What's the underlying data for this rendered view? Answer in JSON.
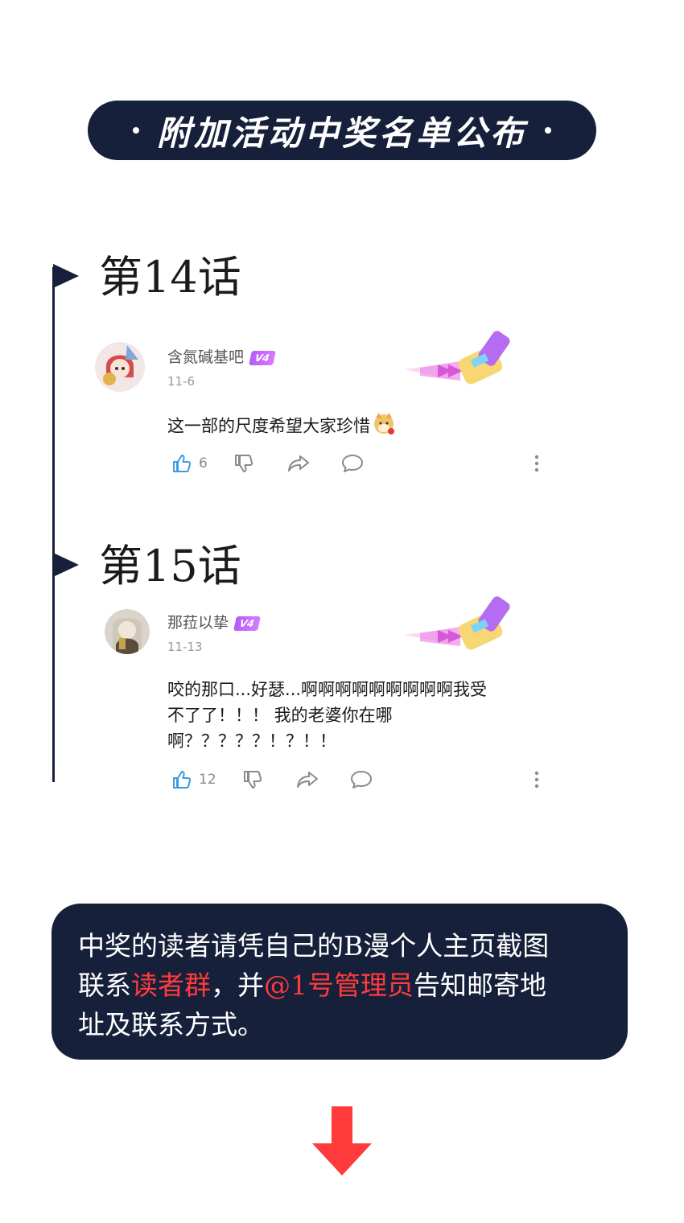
{
  "title": "附加活动中奖名单公布",
  "episodes": [
    {
      "label": "第14话",
      "comment": {
        "username": "含氮碱基吧",
        "vip": "V4",
        "date": "11-6",
        "text": "这一部的尺度希望大家珍惜",
        "likes": "6"
      }
    },
    {
      "label": "第15话",
      "comment": {
        "username": "那菈以挚",
        "vip": "V4",
        "date": "11-13",
        "text_lines": [
          "咬的那口...好瑟...啊啊啊啊啊啊啊啊啊我受",
          "不了了！！！ 我的老婆你在哪",
          "啊？？？？？！？！！"
        ],
        "likes": "12"
      }
    }
  ],
  "notice": {
    "line1": "中奖的读者请凭自己的B漫个人主页截图",
    "line2_a": "联系",
    "line2_hl1": "读者群",
    "line2_b": "，并",
    "line2_hl2": "@1号管理员",
    "line2_c": "告知邮寄地",
    "line3": "址及联系方式。"
  },
  "colors": {
    "navy": "#17203a",
    "highlight_red": "#ff3b3b",
    "like_blue": "#3a9be0",
    "arrow_red": "#ff3b3b"
  },
  "icons": [
    "thumbs-up-icon",
    "thumbs-down-icon",
    "share-icon",
    "reply-icon",
    "more-icon",
    "arrow-down-icon"
  ]
}
